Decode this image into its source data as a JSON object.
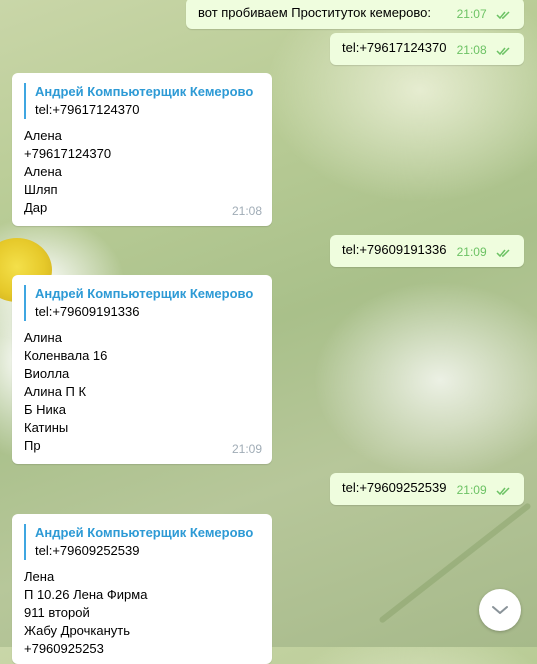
{
  "messages": [
    {
      "type": "out",
      "text": "вот пробиваем Проституток кемерово:",
      "time": "21:07"
    },
    {
      "type": "out",
      "text": "tel:+79617124370",
      "time": "21:08"
    },
    {
      "type": "in",
      "sender": "Андрей Компьютерщик Кемерово",
      "link": "tel:+79617124370",
      "lines": [
        "Алена",
        "+79617124370",
        "Алена",
        "Шляп",
        "Дар"
      ],
      "time": "21:08"
    },
    {
      "type": "out",
      "text": "tel:+79609191336",
      "time": "21:09"
    },
    {
      "type": "in",
      "sender": "Андрей Компьютерщик Кемерово",
      "link": "tel:+79609191336",
      "lines": [
        "Алина",
        "Коленвала 16",
        "Виолла",
        "Алина П К",
        "Б Ника",
        "Катины",
        "Пр"
      ],
      "time": "21:09"
    },
    {
      "type": "out",
      "text": "tel:+79609252539",
      "time": "21:09"
    },
    {
      "type": "in",
      "sender": "Андрей Компьютерщик Кемерово",
      "link": "tel:+79609252539",
      "lines": [
        "Лена",
        "П 10.26 Лена Фирма",
        "911 второй",
        "Жабу Дрочкануть",
        "+7960925253"
      ]
    }
  ],
  "icons": {
    "read": "double-check-icon",
    "scroll": "chevron-down-icon"
  },
  "colors": {
    "outgoing_bubble": "#effdde",
    "incoming_bubble": "#ffffff",
    "sender_name": "#2d9ad5",
    "quote_bar": "#3fa6e1",
    "time_out": "#6cc264",
    "time_in": "#a0acb6"
  }
}
